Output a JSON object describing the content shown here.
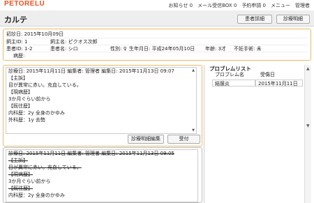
{
  "app": {
    "logo": "PETORELU",
    "logo_sub": "カルテ"
  },
  "topnav": {
    "notice": "お知らせ 0",
    "mail": "メール受信BOX 0",
    "reservation": "予約申請 0",
    "menu": "メニュー",
    "admin": "管理者"
  },
  "header": {
    "title": "カルテ",
    "patient_detail": "患者詳細",
    "statement": "診療明細"
  },
  "info": {
    "first_visit": "初診日: 2015年10月09日",
    "owner_id": "飼主ID: 1",
    "owner_name": "飼主名: ピクオス次郎",
    "patient_id": "患者ID: 1-2",
    "patient_name": "患者名: シロ",
    "sex": "性別: ♀",
    "birthday": "生年月日: 平成24年05月10日",
    "age": "年齢: 3才",
    "sterilization": "不妊手術: 未",
    "history": "病歴:"
  },
  "note": {
    "header": "診療日: 2015年11月11日 編集者: 管理者 編集日: 2015年11月13日 09:07",
    "lines": [
      "【主訴】",
      "目が異常に赤い。充血している。",
      "【現病歴】",
      "3か月ぐらい前から",
      "【既往歴】",
      "内科歴：2y 全身のかゆみ",
      "外科歴：1y 去勢"
    ],
    "edit_button": "診療明細編集",
    "accept_button": "受付"
  },
  "old_note": {
    "header": "診療日: 2015年11月11日 編集者: 管理者 編集日: 2015年11月13日 09:05",
    "lines": [
      "【主訴】",
      "目が異常に赤い。充血している。",
      "【現病歴】",
      "3か月ぐらい前から",
      "【既往歴】",
      "内科歴：2y 全身のかゆみ"
    ]
  },
  "problem_list": {
    "title": "プロブレムリスト",
    "col_name": "プロブレム名",
    "col_date": "受傷日",
    "rows": [
      {
        "name": "結膜炎",
        "date": "2015年11月11日"
      }
    ]
  }
}
